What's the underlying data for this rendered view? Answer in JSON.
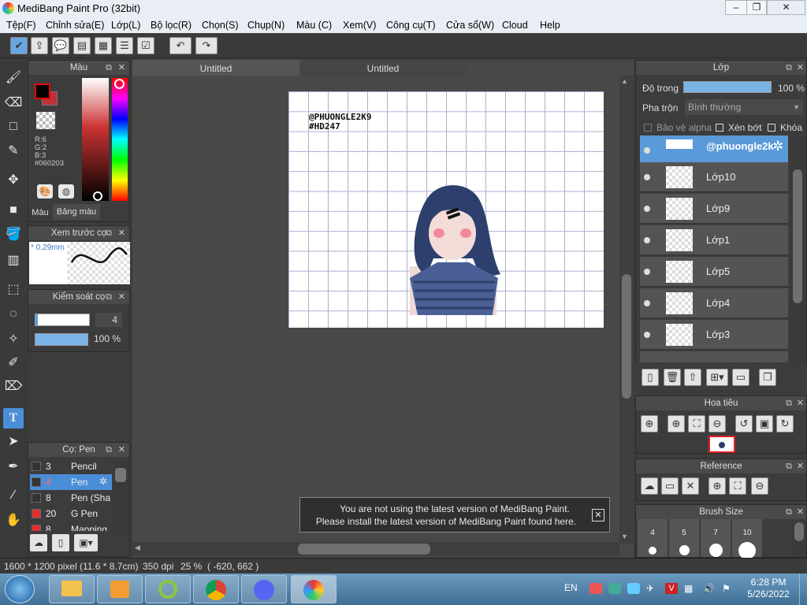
{
  "window": {
    "title": "MediBang Paint Pro (32bit)"
  },
  "menu": [
    "Tệp(F)",
    "Chỉnh sửa(E)",
    "Lớp(L)",
    "Bộ lọc(R)",
    "Chọn(S)",
    "Chụp(N)",
    "Màu (C)",
    "Xem(V)",
    "Công cụ(T)",
    "Cửa sổ(W)",
    "Cloud",
    "Help"
  ],
  "tabs": [
    "Untitled",
    "Untitled"
  ],
  "color_panel": {
    "title": "Màu",
    "r": "R:6",
    "g": "G:2",
    "b": "B:3",
    "hex": "#060203",
    "tab_color": "Màu",
    "tab_palette": "Bảng màu",
    "main_color": "#060203",
    "sub_color": "#c0303a"
  },
  "brush_preview": {
    "title": "Xem trước cọ",
    "size": "* 0,29mm"
  },
  "brush_control": {
    "title": "Kiểm soát cọ",
    "size": "4",
    "opacity": "100 %"
  },
  "brush_list": {
    "title": "Cọ: Pen",
    "items": [
      {
        "size": "3",
        "name": "Pencil",
        "color": "#333333"
      },
      {
        "size": "4",
        "name": "Pen",
        "color": "#333333"
      },
      {
        "size": "8",
        "name": "Pen (Sha",
        "color": "#333333"
      },
      {
        "size": "20",
        "name": "G Pen",
        "color": "#e03030"
      },
      {
        "size": "8",
        "name": "Mapping",
        "color": "#e03030"
      }
    ]
  },
  "layers": {
    "title": "Lớp",
    "opacity_label": "Độ trong",
    "opacity_value": "100 %",
    "blend_label": "Pha trộn",
    "blend_value": "Bình thường",
    "protect_alpha": "Bảo vệ alpha",
    "clipping": "Xén bớt",
    "lock": "Khóa",
    "items": [
      "@phuongle2k",
      "Lớp10",
      "Lớp9",
      "Lớp1",
      "Lớp5",
      "Lớp4",
      "Lớp3"
    ]
  },
  "navigator": {
    "title": "Hoa tiêu"
  },
  "reference": {
    "title": "Reference"
  },
  "brush_size": {
    "title": "Brush Size",
    "sizes": [
      "4",
      "5",
      "7",
      "10"
    ]
  },
  "canvas": {
    "text1": "@PHUONGLE2K9",
    "text2": "#HD247"
  },
  "notice": {
    "line1": "You are not using the latest version of MediBang Paint.",
    "line2": "Please install the latest version of MediBang Paint found here."
  },
  "status": {
    "size": "1600 * 1200 pixel",
    "cm": "(11.6 * 8.7cm)",
    "dpi": "350 dpi",
    "zoom": "25 %",
    "coords": "( -620, 662 )"
  },
  "taskbar": {
    "lang": "EN",
    "time": "6:28 PM",
    "date": "5/26/2022"
  }
}
